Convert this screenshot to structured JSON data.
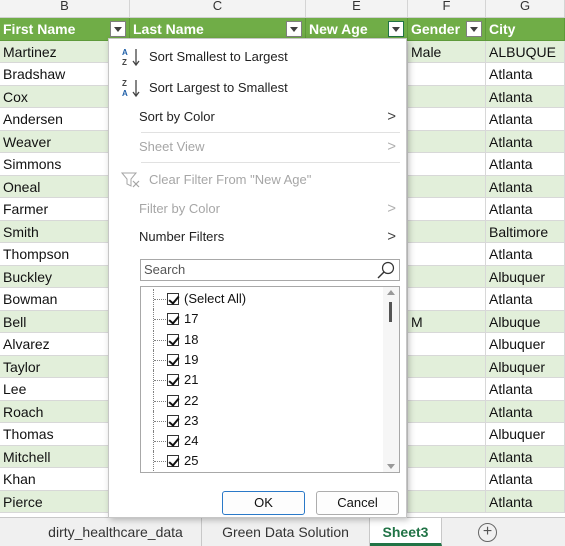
{
  "column_letters": [
    "B",
    "C",
    "E",
    "F",
    "G"
  ],
  "headers": {
    "first_name": "First Name",
    "last_name": "Last Name",
    "new_age": "New Age",
    "gender": "Gender",
    "city": "City"
  },
  "rows": [
    {
      "first": "Martinez",
      "gender": "Male",
      "city": "ALBUQUE"
    },
    {
      "first": "Bradshaw",
      "gender": "",
      "city": "Atlanta"
    },
    {
      "first": "Cox",
      "gender": "",
      "city": "Atlanta"
    },
    {
      "first": "Andersen",
      "gender": "",
      "city": "Atlanta"
    },
    {
      "first": "Weaver",
      "gender": "",
      "city": "Atlanta"
    },
    {
      "first": "Simmons",
      "gender": "",
      "city": "Atlanta"
    },
    {
      "first": "Oneal",
      "gender": "",
      "city": "Atlanta"
    },
    {
      "first": "Farmer",
      "gender": "",
      "city": "Atlanta"
    },
    {
      "first": "Smith",
      "gender": "",
      "city": "Baltimore"
    },
    {
      "first": "Thompson",
      "gender": "",
      "city": "Atlanta"
    },
    {
      "first": "Buckley",
      "gender": "",
      "city": "Albuquer"
    },
    {
      "first": "Bowman",
      "gender": "",
      "city": "Atlanta"
    },
    {
      "first": "Bell",
      "gender": "M",
      "city": "Albuque"
    },
    {
      "first": "Alvarez",
      "gender": "",
      "city": "Albuquer"
    },
    {
      "first": "Taylor",
      "gender": "",
      "city": "Albuquer"
    },
    {
      "first": "Lee",
      "gender": "",
      "city": "Atlanta"
    },
    {
      "first": "Roach",
      "gender": "",
      "city": "Atlanta"
    },
    {
      "first": "Thomas",
      "gender": "",
      "city": "Albuquer"
    },
    {
      "first": "Mitchell",
      "gender": "",
      "city": "Atlanta"
    },
    {
      "first": "Khan",
      "gender": "",
      "city": "Atlanta"
    },
    {
      "first": "Pierce",
      "gender": "",
      "city": "Atlanta"
    }
  ],
  "tabs": [
    {
      "label": "dirty_healthcare_data"
    },
    {
      "label": "Green Data Solution"
    },
    {
      "label": "Sheet3"
    }
  ],
  "add_sheet_glyph": "+",
  "menu": {
    "sort_asc": "Sort Smallest to Largest",
    "sort_desc": "Sort Largest to Smallest",
    "sort_by_color": "Sort by Color",
    "sheet_view": "Sheet View",
    "clear_filter": "Clear Filter From \"New Age\"",
    "filter_by_color": "Filter by Color",
    "number_filters": "Number Filters",
    "search_placeholder": "Search",
    "arrow": ">",
    "items": [
      "(Select All)",
      "17",
      "18",
      "19",
      "21",
      "22",
      "23",
      "24",
      "25"
    ],
    "ok": "OK",
    "cancel": "Cancel"
  },
  "colors": {
    "header_green": "#70ad47",
    "band_green": "#e2efda",
    "accent": "#217346"
  }
}
